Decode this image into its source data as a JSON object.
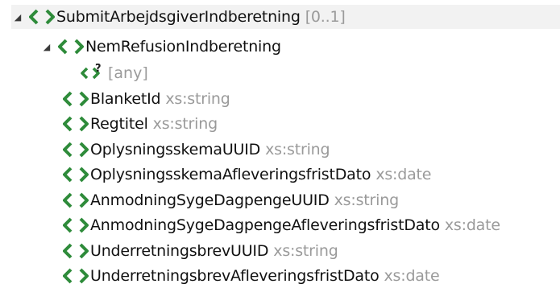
{
  "tree": {
    "root": {
      "name": "SubmitArbejdsgiverIndberetning",
      "cardinality": "[0..1]",
      "expanded": true
    },
    "child": {
      "name": "NemRefusionIndberetning",
      "expanded": true
    },
    "any": {
      "label": "[any]",
      "badge": "?"
    },
    "elements": [
      {
        "name": "BlanketId",
        "type": "xs:string"
      },
      {
        "name": "Regtitel",
        "type": "xs:string"
      },
      {
        "name": "OplysningsskemaUUID",
        "type": "xs:string"
      },
      {
        "name": "OplysningsskemaAfleveringsfristDato",
        "type": "xs:date"
      },
      {
        "name": "AnmodningSygeDagpengeUUID",
        "type": "xs:string"
      },
      {
        "name": "AnmodningSygeDagpengeAfleveringsfristDato",
        "type": "xs:date"
      },
      {
        "name": "UnderretningsbrevUUID",
        "type": "xs:string"
      },
      {
        "name": "UnderretningsbrevAfleveringsfristDato",
        "type": "xs:date"
      }
    ]
  },
  "icons": {
    "expand": "expanded-triangle-icon",
    "element": "xml-element-icon",
    "any": "xml-any-element-icon"
  },
  "colors": {
    "icon_green": "#2e8b3a",
    "type_gray": "#9a9a9a",
    "selected_bg": "#f2f2f2"
  }
}
